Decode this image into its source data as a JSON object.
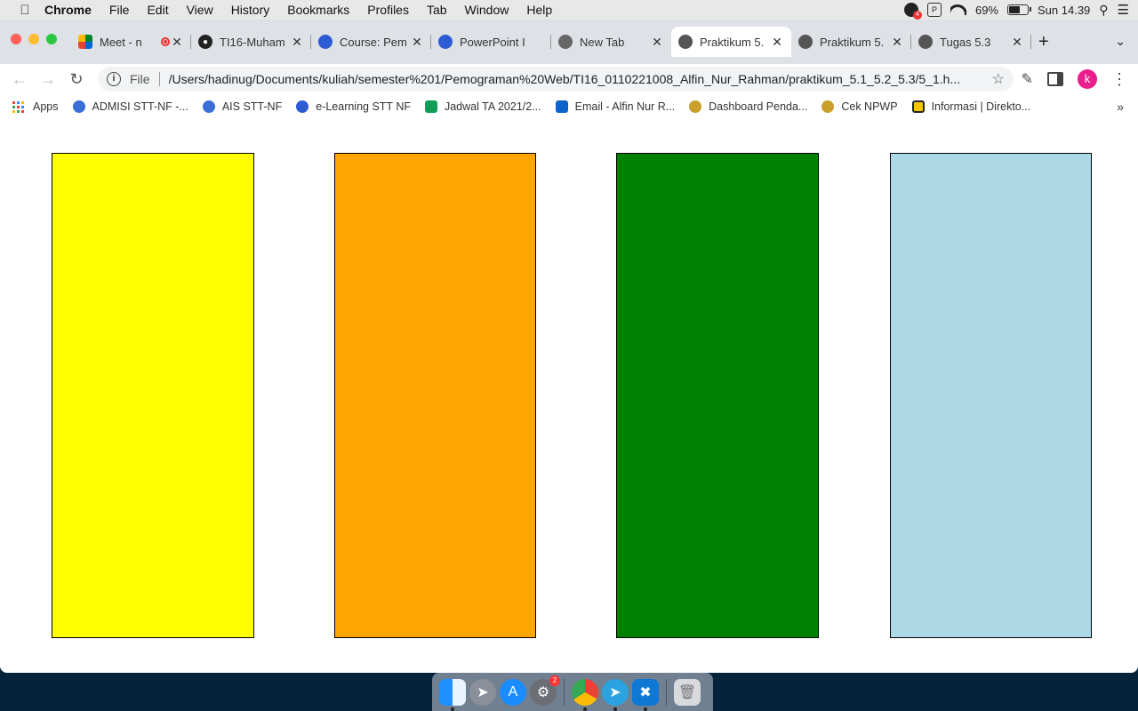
{
  "menubar": {
    "app_name": "Chrome",
    "items": [
      "File",
      "Edit",
      "View",
      "History",
      "Bookmarks",
      "Profiles",
      "Tab",
      "Window",
      "Help"
    ],
    "notification_count": "4",
    "battery_percent": "69%",
    "battery_level": 0.69,
    "clock": "Sun 14.39"
  },
  "tabs": [
    {
      "title": "Meet - n",
      "favicon": "google-meet-icon",
      "active": false,
      "recording": true
    },
    {
      "title": "TI16-Muham",
      "favicon": "github-icon",
      "active": false
    },
    {
      "title": "Course: Pem",
      "favicon": "elearning-icon",
      "active": false
    },
    {
      "title": "PowerPoint I",
      "favicon": "elearning-icon",
      "active": false
    },
    {
      "title": "New Tab",
      "favicon": "chrome-icon",
      "active": false
    },
    {
      "title": "Praktikum 5.",
      "favicon": "globe-icon",
      "active": true
    },
    {
      "title": "Praktikum 5.",
      "favicon": "globe-icon",
      "active": false
    },
    {
      "title": "Tugas 5.3",
      "favicon": "globe-icon",
      "active": false
    }
  ],
  "toolbar": {
    "scheme_label": "File",
    "url": "/Users/hadinug/Documents/kuliah/semester%201/Pemograman%20Web/TI16_0110221008_Alfin_Nur_Rahman/praktikum_5.1_5.2_5.3/5_1.h...",
    "profile_initial": "k"
  },
  "bookmarks": [
    {
      "label": "Apps",
      "icon": "apps-grid-icon"
    },
    {
      "label": "ADMISI STT-NF -...",
      "icon": "sttnf-icon"
    },
    {
      "label": "AIS STT-NF",
      "icon": "sttnf-icon"
    },
    {
      "label": "e-Learning STT NF",
      "icon": "elearning-icon"
    },
    {
      "label": "Jadwal TA 2021/2...",
      "icon": "sheets-icon"
    },
    {
      "label": "Email - Alfin Nur R...",
      "icon": "outlook-icon"
    },
    {
      "label": "Dashboard Penda...",
      "icon": "emblem-icon"
    },
    {
      "label": "Cek NPWP",
      "icon": "emblem-icon"
    },
    {
      "label": "Informasi | Direkto...",
      "icon": "direktori-icon"
    }
  ],
  "page": {
    "boxes": [
      {
        "name": "yellow-box",
        "color": "#ffff00"
      },
      {
        "name": "orange-box",
        "color": "#ffa500"
      },
      {
        "name": "green-box",
        "color": "#008000"
      },
      {
        "name": "lightblue-box",
        "color": "#add8e6"
      }
    ]
  },
  "dock": {
    "apps": [
      "finder-icon",
      "launchpad-icon",
      "app-store-icon",
      "system-preferences-icon",
      "chrome-icon",
      "telegram-icon",
      "vscode-icon",
      "trash-icon"
    ],
    "system_preferences_badge": "2"
  }
}
